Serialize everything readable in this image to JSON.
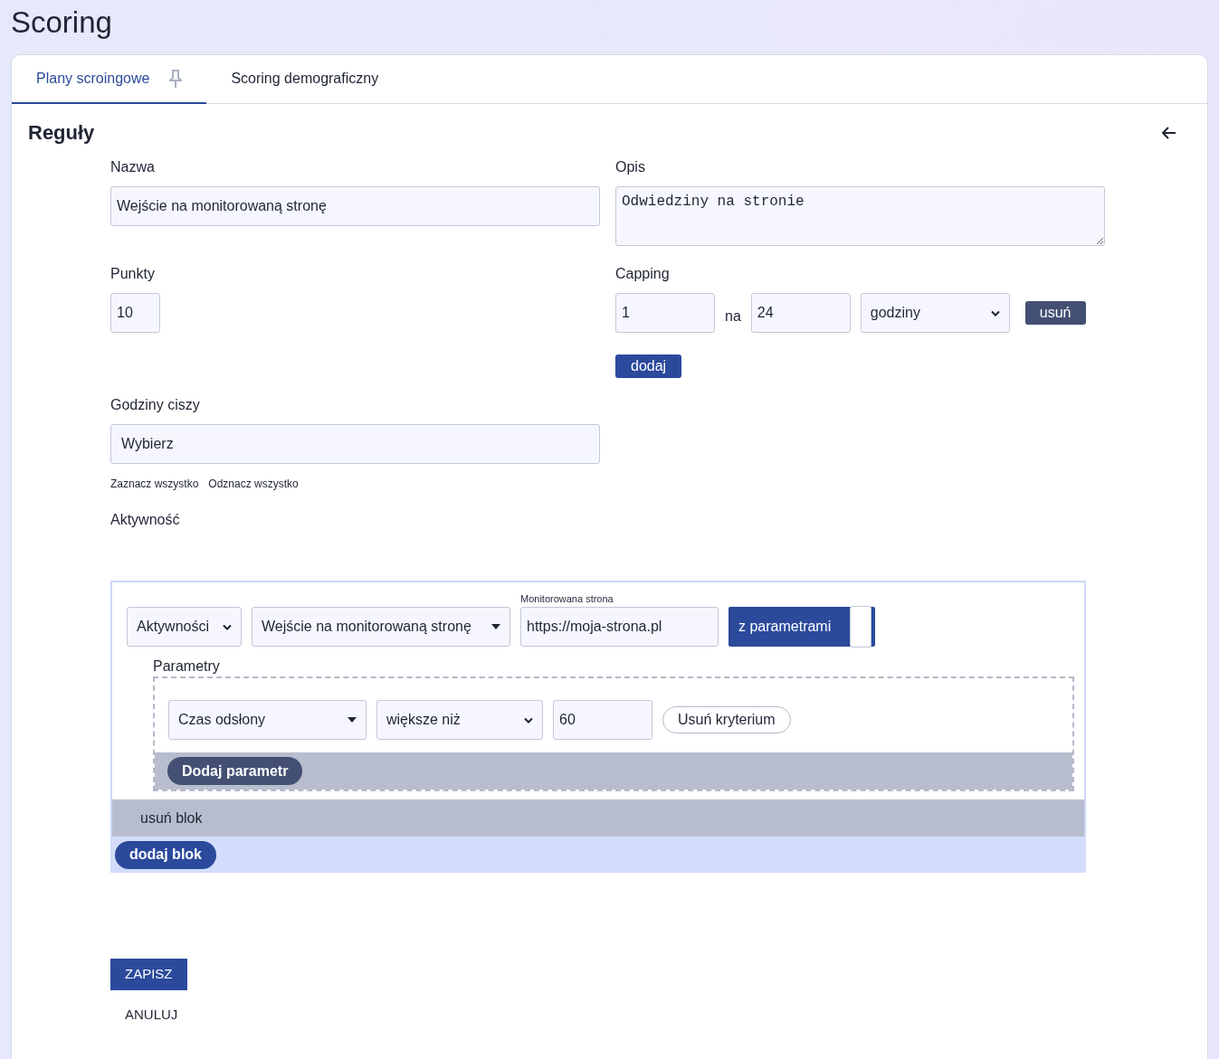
{
  "page_title": "Scoring",
  "tabs": [
    {
      "label": "Plany scroingowe",
      "selected": true,
      "pinned": true
    },
    {
      "label": "Scoring demograficzny",
      "selected": false,
      "pinned": false
    }
  ],
  "section_title": "Reguły",
  "form": {
    "name": {
      "label": "Nazwa",
      "value": "Wejście na monitorowaną stronę"
    },
    "description": {
      "label": "Opis",
      "value": "Odwiedziny na stronie"
    },
    "points": {
      "label": "Punkty",
      "value": "10"
    },
    "capping": {
      "label": "Capping",
      "rows": [
        {
          "count": "1",
          "separator": "na",
          "period": "24",
          "unit": "godziny",
          "remove": "usuń"
        }
      ],
      "add": "dodaj"
    },
    "quiet_hours": {
      "label": "Godziny ciszy",
      "placeholder": "Wybierz",
      "select_all": "Zaznacz wszystko",
      "deselect_all": "Odznacz wszystko"
    },
    "activity": {
      "label": "Aktywność",
      "blocks": [
        {
          "type": "Aktywności",
          "activity": "Wejście na monitorowaną stronę",
          "url_label": "Monitorowana strona",
          "url": "https://moja-strona.pl",
          "toggle": {
            "label": "z parametrami",
            "on": true
          },
          "params_label": "Parametry",
          "criteria": [
            {
              "field": "Czas odsłony",
              "operator": "większe niż",
              "value": "60",
              "remove": "Usuń kryterium"
            }
          ],
          "add_param": "Dodaj parametr",
          "remove_block": "usuń blok"
        }
      ],
      "add_block": "dodaj blok"
    }
  },
  "actions": {
    "save": "ZAPISZ",
    "cancel": "ANULUJ"
  }
}
